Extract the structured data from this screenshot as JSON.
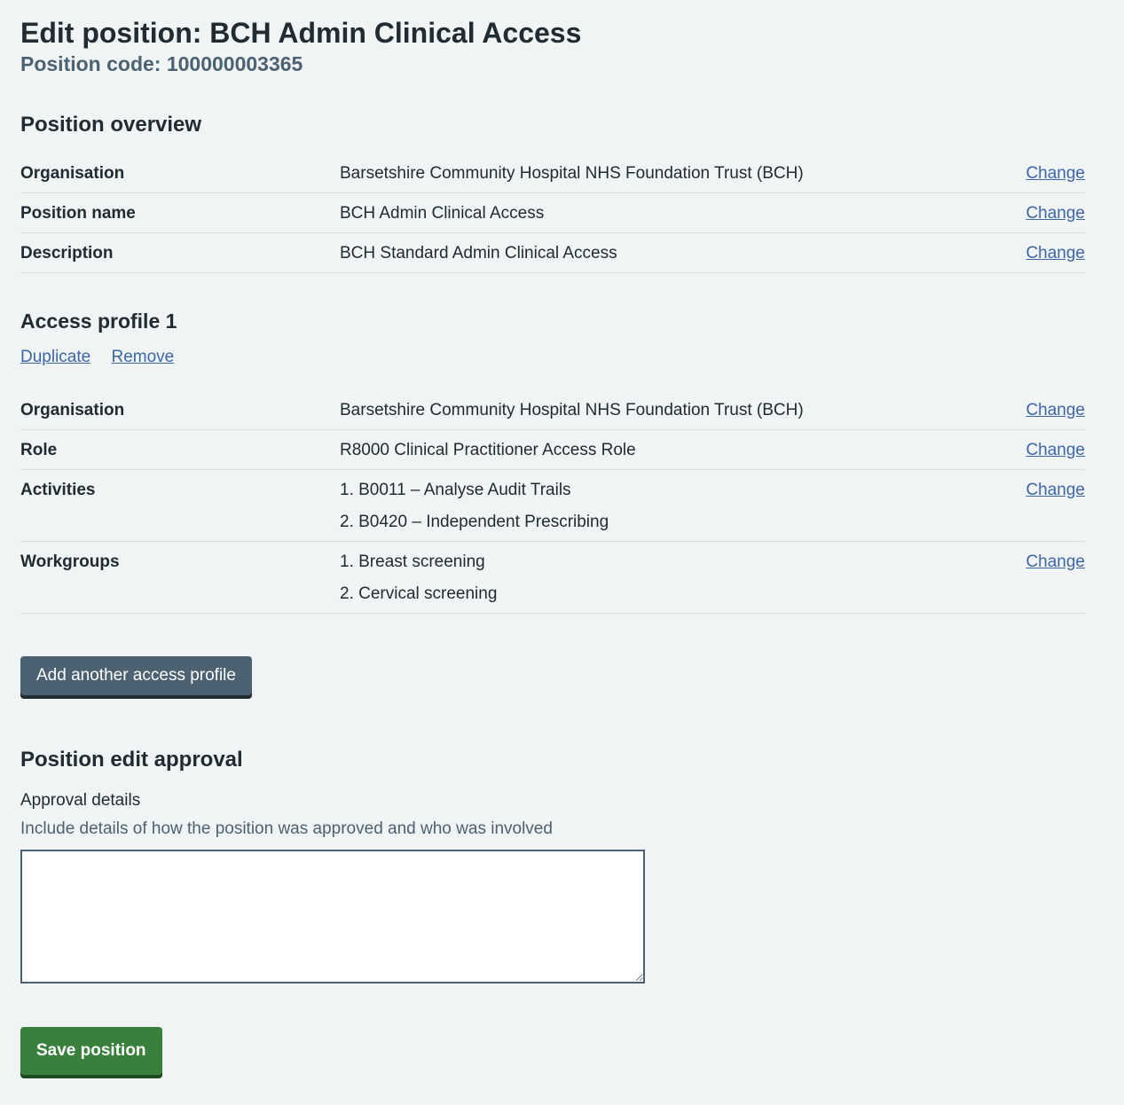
{
  "header": {
    "title": "Edit position: BCH Admin Clinical Access",
    "position_code": "Position code: 100000003365"
  },
  "overview": {
    "heading": "Position overview",
    "rows": [
      {
        "key": "Organisation",
        "value": "Barsetshire Community Hospital NHS Foundation Trust (BCH)",
        "action": "Change"
      },
      {
        "key": "Position name",
        "value": "BCH Admin Clinical Access",
        "action": "Change"
      },
      {
        "key": "Description",
        "value": "BCH Standard Admin Clinical Access",
        "action": "Change"
      }
    ]
  },
  "access_profile": {
    "heading": "Access profile 1",
    "duplicate_label": "Duplicate",
    "remove_label": "Remove",
    "rows": [
      {
        "key": "Organisation",
        "items": [
          "Barsetshire Community Hospital NHS Foundation Trust (BCH)"
        ],
        "action": "Change"
      },
      {
        "key": "Role",
        "items": [
          "R8000 Clinical Practitioner Access Role"
        ],
        "action": "Change"
      },
      {
        "key": "Activities",
        "items": [
          "1. B0011 – Analyse Audit Trails",
          "2. B0420 – Independent Prescribing"
        ],
        "action": "Change"
      },
      {
        "key": "Workgroups",
        "items": [
          "1. Breast screening",
          "2. Cervical screening"
        ],
        "action": "Change"
      }
    ]
  },
  "add_profile_button": "Add another access profile",
  "approval": {
    "heading": "Position edit approval",
    "label": "Approval details",
    "hint": "Include details of how the position was approved and who was involved",
    "value": ""
  },
  "save_button": "Save position",
  "colors": {
    "background": "#f0f4f5",
    "text": "#212b32",
    "secondary_text": "#4c6272",
    "link": "#3d66a8",
    "primary_button": "#38803c",
    "secondary_button": "#4c6272"
  }
}
